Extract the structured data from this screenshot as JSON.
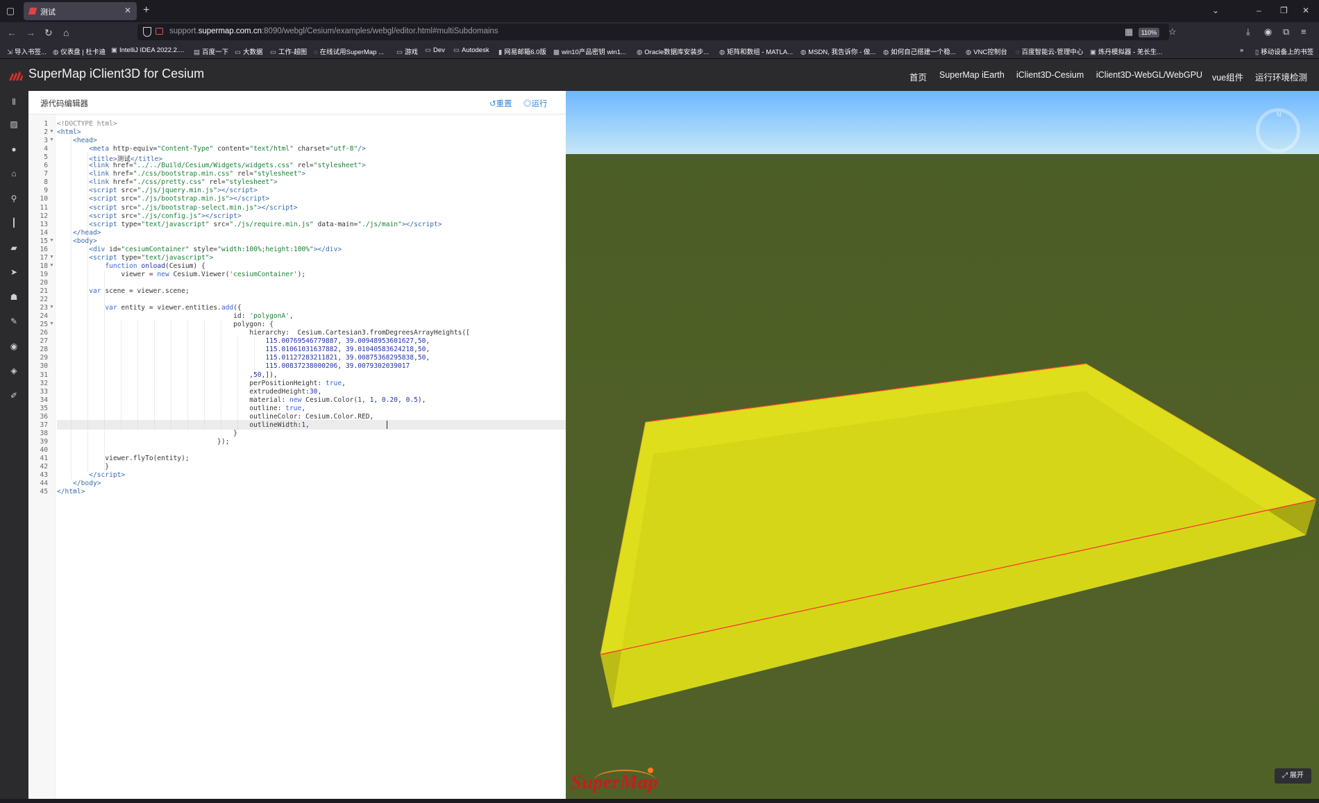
{
  "browser": {
    "tab_title": "测试",
    "url_prefix": "support.",
    "url_domain": "supermap.com.cn",
    "url_rest": ":8090/webgl/Cesium/examples/webgl/editor.html#multiSubdomains",
    "zoom": "110%",
    "bookmarks": [
      "导入书签...",
      "仪表盘 | 杜卡迪",
      "IntelliJ IDEA 2022.2....",
      "百度一下",
      "大数据",
      "工作-超图",
      "在线试用SuperMap ...",
      "游戏",
      "Dev",
      "Autodesk",
      "网易邮箱6.0版",
      "win10产品密钥 win1...",
      "Oracle数据库安装步...",
      "矩阵和数组 - MATLA...",
      "MSDN, 我告诉你 - 做...",
      "如何自己搭建一个稳...",
      "VNC控制台",
      "百度智能云-管理中心",
      "炼丹模拟器 - 羌长生...",
      "移动设备上的书签"
    ]
  },
  "app": {
    "title": "SuperMap iClient3D for Cesium",
    "nav": [
      "首页",
      "SuperMap iEarth",
      "iClient3D-Cesium",
      "iClient3D-WebGL/WebGPU",
      "vue组件",
      "运行环境检测"
    ]
  },
  "editor": {
    "title": "源代码编辑器",
    "reset_label": "重置",
    "run_label": "运行"
  },
  "viewer": {
    "compass_label": "N",
    "expand_label": "展开",
    "watermark": "SuperMap",
    "polygon_fill": "#e6e61a",
    "outline_color": "#ff2a2a",
    "ground_color": "#4e5f27"
  }
}
